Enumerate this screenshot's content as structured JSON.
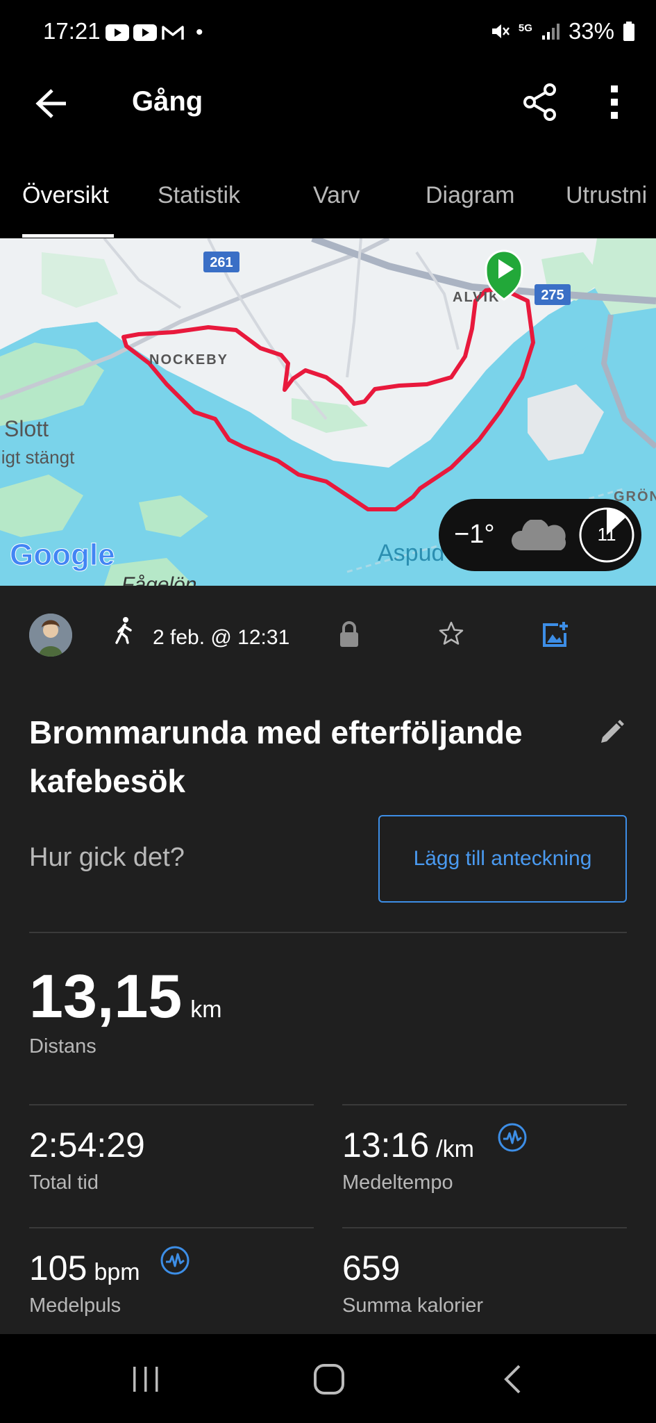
{
  "status_bar": {
    "time": "17:21",
    "dot": "•",
    "network": "5G",
    "battery": "33%",
    "icons": [
      "youtube-icon",
      "youtube-icon",
      "gmail-icon",
      "mute-icon",
      "signal-icon",
      "battery-icon"
    ]
  },
  "app_bar": {
    "title": "Gång",
    "icons": [
      "back-arrow-icon",
      "share-icon",
      "more-vert-icon"
    ]
  },
  "tabs": [
    {
      "label": "Översikt",
      "active": true
    },
    {
      "label": "Statistik",
      "active": false
    },
    {
      "label": "Varv",
      "active": false
    },
    {
      "label": "Diagram",
      "active": false
    },
    {
      "label": "Utrustni",
      "active": false
    }
  ],
  "map": {
    "labels": {
      "road_261": "261",
      "road_275": "275",
      "alvik": "ALVIK",
      "nockeby": "NOCKEBY",
      "slott": "Slott",
      "slott_sub": "ligt stängt",
      "aspud": "Aspud",
      "gron": "GRÖN",
      "fagelon": "Fågelön",
      "google": "Google"
    },
    "route_color": "#e8193c",
    "start_marker_color": "#22a839"
  },
  "weather": {
    "temperature": "−1°",
    "icon": "cloud-icon",
    "wind": "11"
  },
  "activity": {
    "date": "2 feb. @ 12:31",
    "type_icon": "walking-icon",
    "title": "Brommarunda med efterföljande kafebesök"
  },
  "notes": {
    "prompt": "Hur gick det?",
    "button_label": "Lägg till anteckning"
  },
  "stats": {
    "distance": {
      "value": "13,15",
      "unit": "km",
      "label": "Distans"
    },
    "total_time": {
      "value": "2:54:29",
      "label": "Total tid"
    },
    "avg_pace": {
      "value": "13:16",
      "unit": "/km",
      "label": "Medeltempo"
    },
    "avg_hr": {
      "value": "105",
      "unit": "bpm",
      "label": "Medelpuls"
    },
    "calories": {
      "value": "659",
      "label": "Summa kalorier"
    }
  },
  "colors": {
    "accent_blue": "#3d8ee6",
    "background": "#1f1f1f"
  }
}
